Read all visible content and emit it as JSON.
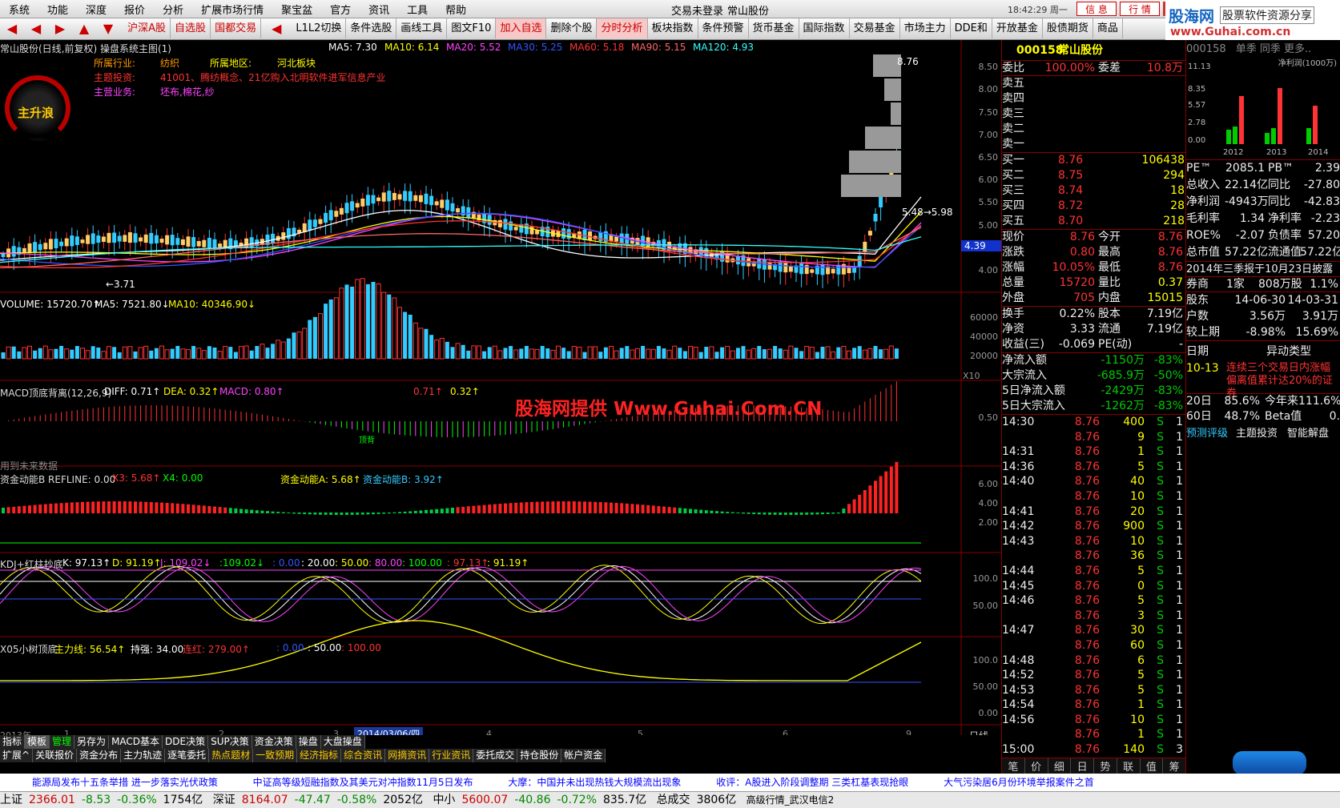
{
  "menu": [
    "系统",
    "功能",
    "深度",
    "报价",
    "分析",
    "扩展市场行情",
    "聚宝盆",
    "官方",
    "资讯",
    "工具",
    "帮助"
  ],
  "title": {
    "login": "交易未登录",
    "stock": "常山股份",
    "clock": "18:42:29 周一",
    "btn_msg": "信 息",
    "btn_trade": "行 情",
    "brand": "股海网",
    "brand_sub": "股票软件资源分享",
    "brand_url": "www.Guhai.com.cn"
  },
  "toolbar": [
    "沪深A股",
    "自选股",
    "国都交易",
    "L1L2切换",
    "条件选股",
    "画线工具",
    "图文F10",
    "加入自选",
    "删除个股",
    "分时分析",
    "板块指数",
    "条件预警",
    "货币基金",
    "国际指数",
    "交易基金",
    "市场主力",
    "DDE和",
    "开放基金",
    "股债期货",
    "商品"
  ],
  "chart_header": {
    "name": "常山股份(日线,前复权) 操盘系统主图(1)",
    "ma5": "MA5: 7.30",
    "ma10": "MA10: 6.14",
    "ma20": "MA20: 5.52",
    "ma30": "MA30: 5.25",
    "ma60": "MA60: 5.18",
    "ma90": "MA90: 5.15",
    "ma120": "MA120: 4.93"
  },
  "info": {
    "industry_label": "所属行业:",
    "industry": "纺织",
    "region_label": "所属地区:",
    "region": "河北板块",
    "theme_label": "主题投资:",
    "theme": "41001、腾纺概念、21亿购入北明软件进军信息产业",
    "business_label": "主营业务:",
    "business": "坯布,棉花,纱",
    "gauge_text": "主升浪"
  },
  "price_axis": [
    "8.50",
    "8.00",
    "7.50",
    "7.00",
    "6.50",
    "6.00",
    "5.50",
    "5.00",
    "4.50",
    "4.00"
  ],
  "price_labels": {
    "high": "8.76",
    "mid": "5.48→5.98",
    "low": "←3.71",
    "cur": "4.39"
  },
  "volume": {
    "label": "VOLUME: 15720.70↑",
    "ma5": "MA5: 7521.80↓",
    "ma10": "MA10: 40346.90↓",
    "axis": [
      "60000",
      "40000",
      "20000"
    ],
    "x": "X10"
  },
  "macd": {
    "label": "MACD顶底背离(12,26,9)",
    "diff": "DIFF: 0.71↑",
    "dea": "DEA: 0.32↑",
    "macd": "MACD: 0.80↑",
    "v1": "0.71↑",
    "v2": "0.32↑",
    "axis": "0.50",
    "note": "用到未来数据",
    "watermark": "股海网提供 Www.Guhai.Com.CN",
    "mark": "顶背"
  },
  "fund": {
    "label": "资金动能B  REFLINE: 0.00",
    "x3": "X3: 5.68↑",
    "x4": "X4: 0.00",
    "a": "资金动能A: 5.68↑",
    "b": "资金动能B: 3.92↑",
    "axis": [
      "6.00",
      "4.00",
      "2.00"
    ]
  },
  "kdj": {
    "label": "KDJ+红柱抄底",
    "k": "K: 97.13↑",
    "d": "D: 91.19↑",
    "j": "J: 109.02↓",
    "v1": ":109.02↓",
    "v2": ": 0.00",
    "v3": ": 20.00",
    "v4": ": 50.00",
    "v5": ": 80.00",
    "v6": ": 100.00",
    "v7": ": 97.13↑",
    "v8": ": 91.19↑",
    "axis": [
      "100.0",
      "50.00"
    ]
  },
  "tree": {
    "label": "X05小树顶底",
    "main": "主力线: 56.54↑",
    "strong": "持强: 34.00",
    "red": "连红: 279.00↑",
    "v1": ": 0.00",
    "v2": ": 50.00",
    "v3": ": 100.00",
    "axis": [
      "100.0",
      "50.00",
      "0.00"
    ]
  },
  "dates": {
    "y2013": "2013年",
    "d1": "1",
    "d2": "2",
    "d3": "3",
    "sel": "2014/03/06/四",
    "d4": "4",
    "d5": "5",
    "d6": "6",
    "d9": "9",
    "period": "日线"
  },
  "tabs1": [
    "指标",
    "模板",
    "管理",
    "另存为",
    "MACD基本",
    "DDE决策",
    "SUP决策",
    "资金决策",
    "操盘",
    "大盘操盘"
  ],
  "tabs2": [
    "扩展^",
    "关联报价",
    "资金分布",
    "主力轨迹",
    "逐笔委托",
    "热点题材",
    "一致预期",
    "经济指标",
    "综合资讯",
    "网摘资讯",
    "行业资讯",
    "委托成交",
    "持仓股份",
    "帐户资金"
  ],
  "quote": {
    "code": "000158",
    "name": "常山股份",
    "wb_label": "委比",
    "wb": "100.00%",
    "wc_label": "委差",
    "wc": "10.8万",
    "sells": [
      "卖五",
      "卖四",
      "卖三",
      "卖二",
      "卖一"
    ],
    "buys": [
      {
        "n": "买一",
        "p": "8.76",
        "v": "106438"
      },
      {
        "n": "买二",
        "p": "8.75",
        "v": "294"
      },
      {
        "n": "买三",
        "p": "8.74",
        "v": "18"
      },
      {
        "n": "买四",
        "p": "8.72",
        "v": "28"
      },
      {
        "n": "买五",
        "p": "8.70",
        "v": "218"
      }
    ],
    "stats": [
      [
        "现价",
        "8.76",
        "今开",
        "8.76"
      ],
      [
        "涨跌",
        "0.80",
        "最高",
        "8.76"
      ],
      [
        "涨幅",
        "10.05%",
        "最低",
        "8.76"
      ],
      [
        "总量",
        "15720",
        "量比",
        "0.37"
      ],
      [
        "外盘",
        "705",
        "内盘",
        "15015"
      ]
    ],
    "stats2": [
      [
        "换手",
        "0.22%",
        "股本",
        "7.19亿"
      ],
      [
        "净资",
        "3.33",
        "流通",
        "7.19亿"
      ],
      [
        "收益(三)",
        "-0.069",
        "PE(动)",
        "-"
      ]
    ],
    "flow": [
      [
        "净流入额",
        "-1150万",
        "-83%"
      ],
      [
        "大宗流入",
        "-685.9万",
        "-50%"
      ],
      [
        "5日净流入额",
        "-2429万",
        "-83%"
      ],
      [
        "5日大宗流入",
        "-1262万",
        "-83%"
      ]
    ],
    "ticks": [
      [
        "14:30",
        "8.76",
        "400",
        "S",
        "1"
      ],
      [
        "",
        "8.76",
        "9",
        "S",
        "1"
      ],
      [
        "14:31",
        "8.76",
        "1",
        "S",
        "1"
      ],
      [
        "14:36",
        "8.76",
        "5",
        "S",
        "1"
      ],
      [
        "14:40",
        "8.76",
        "40",
        "S",
        "1"
      ],
      [
        "",
        "8.76",
        "10",
        "S",
        "1"
      ],
      [
        "14:41",
        "8.76",
        "20",
        "S",
        "1"
      ],
      [
        "14:42",
        "8.76",
        "900",
        "S",
        "1"
      ],
      [
        "14:43",
        "8.76",
        "10",
        "S",
        "1"
      ],
      [
        "",
        "8.76",
        "36",
        "S",
        "1"
      ],
      [
        "14:44",
        "8.76",
        "5",
        "S",
        "1"
      ],
      [
        "14:45",
        "8.76",
        "0",
        "S",
        "1"
      ],
      [
        "14:46",
        "8.76",
        "5",
        "S",
        "1"
      ],
      [
        "",
        "8.76",
        "3",
        "S",
        "1"
      ],
      [
        "14:47",
        "8.76",
        "30",
        "S",
        "1"
      ],
      [
        "",
        "8.76",
        "60",
        "S",
        "1"
      ],
      [
        "14:48",
        "8.76",
        "6",
        "S",
        "1"
      ],
      [
        "14:52",
        "8.76",
        "5",
        "S",
        "1"
      ],
      [
        "14:53",
        "8.76",
        "5",
        "S",
        "1"
      ],
      [
        "14:54",
        "8.76",
        "1",
        "S",
        "1"
      ],
      [
        "14:56",
        "8.76",
        "10",
        "S",
        "1"
      ],
      [
        "",
        "8.76",
        "1",
        "S",
        "1"
      ],
      [
        "15:00",
        "8.76",
        "140",
        "S",
        "3"
      ]
    ],
    "rtabs": [
      "笔",
      "价",
      "细",
      "日",
      "势",
      "联",
      "值",
      "筹"
    ]
  },
  "fund_panel": {
    "code": "000158",
    "tabs": "单季 同季 更多..",
    "chart_title": "净利润(1000万)",
    "axis": [
      "11.13",
      "8.35",
      "5.57",
      "2.78",
      "0.00"
    ],
    "years": [
      "2012",
      "2013",
      "2014"
    ],
    "rows": [
      [
        "PE™",
        "2085.1",
        "PB™",
        "2.39"
      ],
      [
        "总收入",
        "22.14亿",
        "同比",
        "-27.80"
      ],
      [
        "净利润",
        "-4943万",
        "同比",
        "-42.83"
      ],
      [
        "毛利率",
        "1.34",
        "净利率",
        "-2.23"
      ],
      [
        "ROE%",
        "-2.07",
        "负债率",
        "57.20"
      ],
      [
        "总市值",
        "57.22亿",
        "流通值",
        "57.22亿"
      ]
    ],
    "report": "2014年三季报于10月23日披露",
    "broker": [
      "券商",
      "1家",
      "808万股",
      "1.1%"
    ],
    "holders": [
      [
        "股东",
        "14-06-30",
        "14-03-31"
      ],
      [
        "户数",
        "3.56万",
        "3.91万"
      ],
      [
        "较上期",
        "-8.98%",
        "15.69%"
      ]
    ],
    "date_label": "日期",
    "type_label": "异动类型",
    "event_date": "10-13",
    "event": "连续三个交易日内涨幅偏离值累计达20%的证券",
    "r20": [
      "20日",
      "85.6%",
      "今年来",
      "111.6%"
    ],
    "r60": [
      "60日",
      "48.7%",
      "Beta值",
      "0."
    ],
    "links": [
      "预测评级",
      "主题投资",
      "智能解盘"
    ]
  },
  "news": [
    "能源局发布十五条举措  进一步落实光伏政策",
    "中证高等级短融指数及其美元对冲指数11月5日发布",
    "大摩：中国并未出现热钱大规模流出现象",
    "收评：A股进入阶段调整期  三类杠基表现抢眼",
    "大气污染居6月份环境举报案件之首"
  ],
  "status": {
    "sh": "上证",
    "sh_v": "2366.01",
    "sh_c": "-8.53",
    "sh_p": "-0.36%",
    "sh_a": "1754亿",
    "sz": "深证",
    "sz_v": "8164.07",
    "sz_c": "-47.47",
    "sz_p": "-0.58%",
    "sz_a": "2052亿",
    "zx": "中小",
    "zx_v": "5600.07",
    "zx_c": "-40.86",
    "zx_p": "-0.72%",
    "zx_a": "835.7亿",
    "total": "总成交",
    "total_v": "3806亿",
    "server": "高级行情_武汉电信2"
  }
}
